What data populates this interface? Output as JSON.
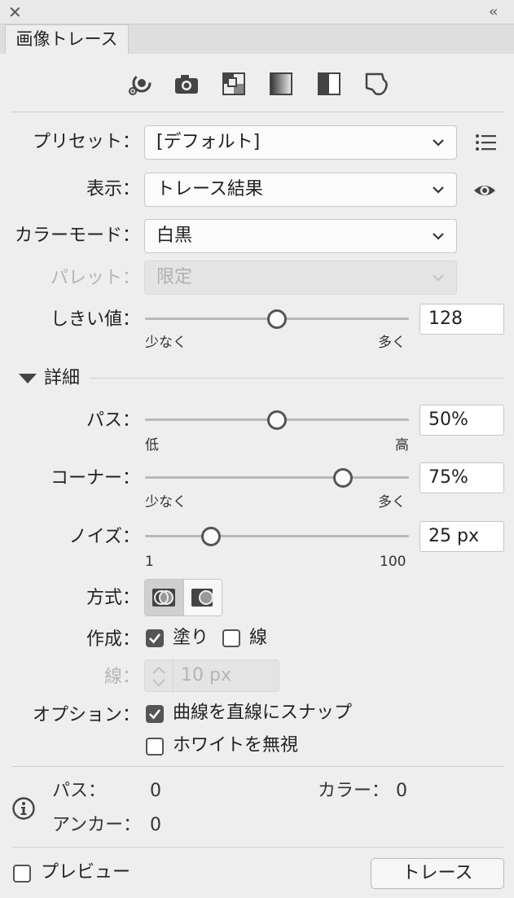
{
  "panel": {
    "tab_title": "画像トレース",
    "close_glyph": "✕",
    "collapse_glyph": "‹‹"
  },
  "presets_icons": [
    "auto-color-icon",
    "high-color-icon",
    "low-color-icon",
    "grayscale-icon",
    "black-white-icon",
    "outline-icon"
  ],
  "rows": {
    "preset": {
      "label": "プリセット：",
      "value": "[デフォルト]"
    },
    "view": {
      "label": "表示：",
      "value": "トレース結果"
    },
    "mode": {
      "label": "カラーモード：",
      "value": "白黒"
    },
    "palette": {
      "label": "パレット：",
      "value": "限定"
    },
    "threshold": {
      "label": "しきい値：",
      "value": "128",
      "min_label": "少なく",
      "max_label": "多く",
      "fraction": 0.5
    }
  },
  "advanced": {
    "header": "詳細",
    "paths": {
      "label": "パス：",
      "value": "50%",
      "min_label": "低",
      "max_label": "高",
      "fraction": 0.5
    },
    "corners": {
      "label": "コーナー：",
      "value": "75%",
      "min_label": "少なく",
      "max_label": "多く",
      "fraction": 0.75
    },
    "noise": {
      "label": "ノイズ：",
      "value": "25 px",
      "min_label": "1",
      "max_label": "100",
      "fraction": 0.25
    },
    "method": {
      "label": "方式："
    },
    "create": {
      "label": "作成：",
      "fill_label": "塗り",
      "fill_checked": true,
      "stroke_label": "線",
      "stroke_checked": false
    },
    "stroke": {
      "label": "線：",
      "value": "10 px"
    },
    "options": {
      "label": "オプション：",
      "snap_label": "曲線を直線にスナップ",
      "snap_checked": true,
      "ignore_white_label": "ホワイトを無視",
      "ignore_white_checked": false
    }
  },
  "info": {
    "paths_label": "パス：",
    "paths_value": "0",
    "colors_label": "カラー：",
    "colors_value": "0",
    "anchors_label": "アンカー：",
    "anchors_value": "0"
  },
  "footer": {
    "preview_label": "プレビュー",
    "preview_checked": false,
    "trace_button": "トレース"
  },
  "colors": {
    "panel_bg": "#eeeeee",
    "icon": "#444444",
    "disabled": "#b5b5b5"
  }
}
